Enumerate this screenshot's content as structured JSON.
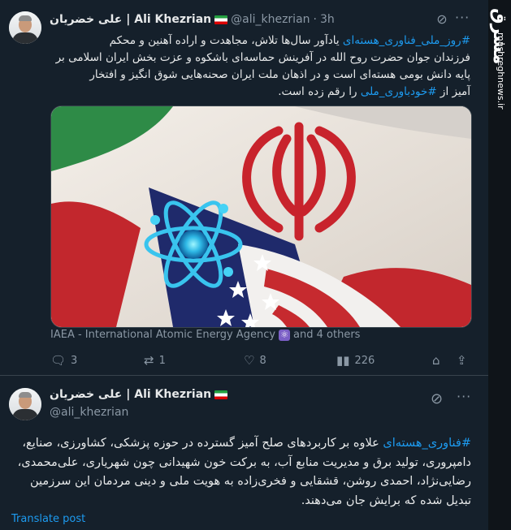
{
  "sidebar": {
    "brand": "مشرق",
    "site": "mashreghnews.ir"
  },
  "post1": {
    "display_name": "علی خضریان | Ali Khezrian",
    "handle": "@ali_khezrian",
    "separator": "·",
    "time": "3h",
    "text_lines": [
      {
        "hashtag": "#روز_ملی_فناوری_هسته‌ای",
        "rest": " یادآور سال‌ها تلاش، مجاهدت و اراده آهنین و محکم"
      },
      {
        "hashtag": "",
        "rest": "فرزندان جوان حضرت روح الله در آفرینش حماسه‌ای باشکوه و عزت بخش ایران اسلامی بر"
      },
      {
        "hashtag": "",
        "rest": "پایه دانش بومی هسته‌ای است و در اذهان ملت ایران صحنه‌هایی شوق انگیز و افتخار"
      }
    ],
    "last_line_prefix": "آمیز از ",
    "last_line_hashtag": "#خودباوری_ملی",
    "last_line_suffix": " را رقم زده است.",
    "media_tags": "IAEA - International Atomic Energy Agency",
    "media_tags_more": "and 4 others",
    "replies": "3",
    "reposts": "1",
    "likes": "8",
    "views": "226"
  },
  "post2": {
    "display_name": "علی خضریان | Ali Khezrian",
    "handle": "@ali_khezrian",
    "hashtag": "#فناوری_هسته‌ای",
    "text": " علاوه بر کاربردهای صلح آمیز گسترده در حوزه پزشکی، کشاورزی، صنایع، دامپروری، تولید برق و مدیریت منابع آب، به برکت خون شهیدانی چون شهریاری، علی‌محمدی، رضایی‌نژاد، احمدی روشن، قشقایی و فخری‌زاده به هویت ملی و دینی مردمان این سرزمین تبدیل شده که برایش جان می‌دهند.",
    "translate": "Translate post"
  },
  "colors": {
    "background": "#15202b",
    "accent": "#1d9bf0",
    "muted": "#8b98a5"
  }
}
